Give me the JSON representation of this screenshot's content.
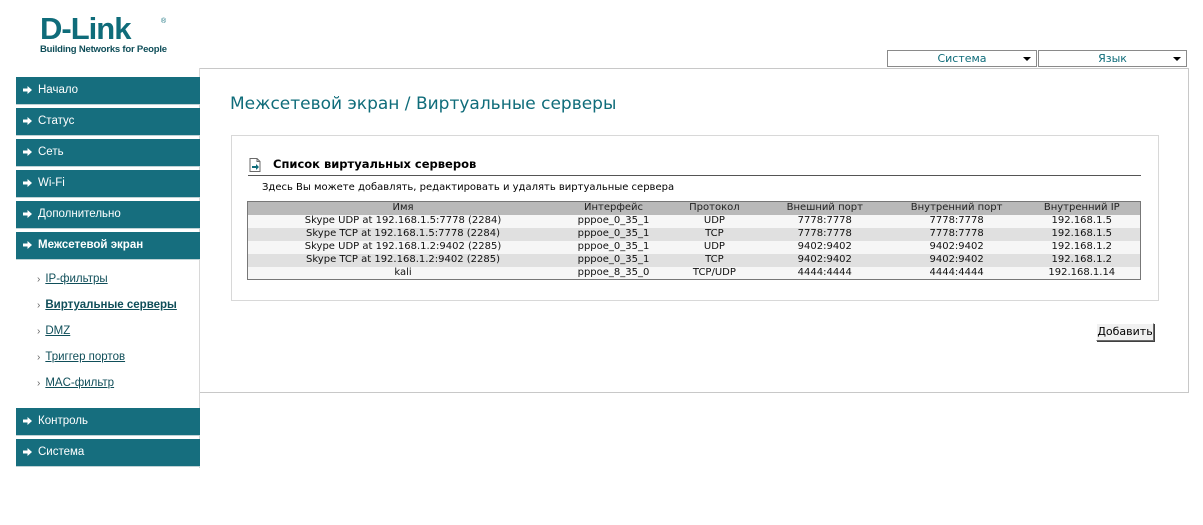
{
  "logo": {
    "brand": "D-Link",
    "tagline": "Building Networks for People"
  },
  "top_selects": [
    {
      "label": "Система"
    },
    {
      "label": "Язык"
    }
  ],
  "sidebar": {
    "items": [
      {
        "label": "Начало"
      },
      {
        "label": "Статус"
      },
      {
        "label": "Сеть"
      },
      {
        "label": "Wi-Fi"
      },
      {
        "label": "Дополнительно"
      },
      {
        "label": "Межсетевой экран"
      },
      {
        "label": "Контроль"
      },
      {
        "label": "Система"
      }
    ],
    "subitems": [
      {
        "label": "IP-фильтры"
      },
      {
        "label": "Виртуальные серверы"
      },
      {
        "label": "DMZ"
      },
      {
        "label": "Триггер портов"
      },
      {
        "label": "MAC-фильтр"
      }
    ]
  },
  "page": {
    "title": "Межсетевой экран /  Виртуальные серверы"
  },
  "panel": {
    "title": "Список виртуальных серверов",
    "description": "Здесь Вы можете добавлять, редактировать и удалять виртуальные сервера"
  },
  "table": {
    "headers": [
      "Имя",
      "Интерфейс",
      "Протокол",
      "Внешний порт",
      "Внутренний порт",
      "Внутренний IP"
    ],
    "rows": [
      [
        "Skype UDP at 192.168.1.5:7778 (2284)",
        "pppoe_0_35_1",
        "UDP",
        "7778:7778",
        "7778:7778",
        "192.168.1.5"
      ],
      [
        "Skype TCP at 192.168.1.5:7778 (2284)",
        "pppoe_0_35_1",
        "TCP",
        "7778:7778",
        "7778:7778",
        "192.168.1.5"
      ],
      [
        "Skype UDP at 192.168.1.2:9402 (2285)",
        "pppoe_0_35_1",
        "UDP",
        "9402:9402",
        "9402:9402",
        "192.168.1.2"
      ],
      [
        "Skype TCP at 192.168.1.2:9402 (2285)",
        "pppoe_0_35_1",
        "TCP",
        "9402:9402",
        "9402:9402",
        "192.168.1.2"
      ],
      [
        "kali",
        "pppoe_8_35_0",
        "TCP/UDP",
        "4444:4444",
        "4444:4444",
        "192.168.1.14"
      ]
    ]
  },
  "actions": {
    "add_label": "Добавить"
  },
  "colors": {
    "accent": "#166e7e",
    "title": "#0f6c7a",
    "header_bg": "#b9b9b9"
  }
}
